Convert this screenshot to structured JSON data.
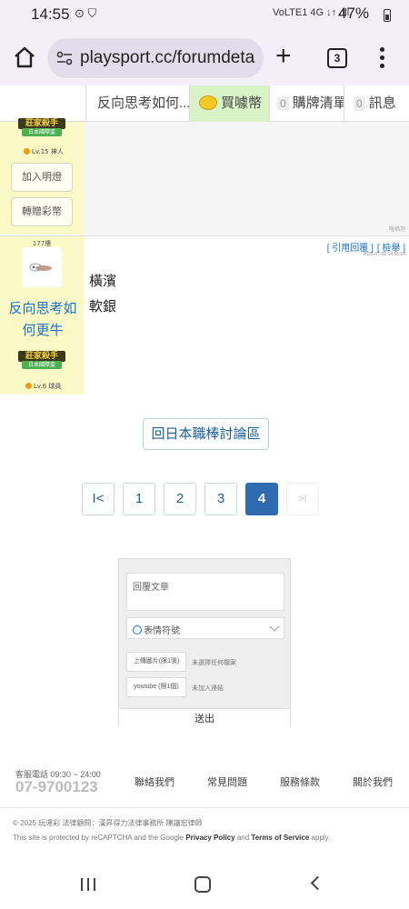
{
  "status_bar": {
    "time": "14:55",
    "left_icons": "⊙ ⛉",
    "network": "VoLTE1 4G ↓↑ .ıll",
    "battery": "47%"
  },
  "browser": {
    "url": "playsport.cc/forumdeta",
    "tab_count": "3"
  },
  "site_nav": {
    "thread_title": "反向思考如何...",
    "buy_coins": "買噱幣",
    "buy_list_count": "0",
    "buy_list": "購牌清單",
    "messages_count": "0",
    "messages": "訊息"
  },
  "post_prev": {
    "badge_title": "莊家殺手",
    "badge_sub": "日本國際盃",
    "level": "Lv.15 神人",
    "light_btn": "加入明燈",
    "gift_btn": "轉贈彩幣",
    "signature": "暱稱泡"
  },
  "post": {
    "floor": "177樓",
    "username": "反向思考如何更牛",
    "badge_title": "莊家殺手",
    "badge_sub": "日本國際盃",
    "level": "Lv.6 球員",
    "quote_reply": "[ 引用回覆 ]",
    "report": "[ 檢舉 ]",
    "timestamp": "2025-07-02 14:55:14",
    "body_line1": "橫濱",
    "body_line2": "軟銀"
  },
  "back_button": "回日本職棒討論區",
  "pagination": {
    "first": "I<",
    "pages": [
      "1",
      "2",
      "3",
      "4"
    ],
    "current": "4",
    "last": ">I"
  },
  "reply_form": {
    "placeholder": "回覆文章",
    "emoji_label": "表情符號",
    "upload_image_btn": "上傳圖片(限1張)",
    "upload_image_note": "未選擇任何檔案",
    "youtube_btn": "youtube (限1個)",
    "youtube_note": "未加入連結",
    "submit": "送出"
  },
  "footer": {
    "hours": "客服電話 09:30 ~ 24:00",
    "phone": "07-9700123",
    "links": [
      "聯絡我們",
      "常見問題",
      "服務條款",
      "關於我們"
    ],
    "copyright": "© 2025 玩運彩 法律顧問：漢昇得力法律事務所 陳議宏律師",
    "recaptcha_prefix": "This site is protected by reCAPTCHA and the Google",
    "privacy": "Privacy Policy",
    "and": "and",
    "terms": "Terms of Service",
    "apply": "apply."
  }
}
